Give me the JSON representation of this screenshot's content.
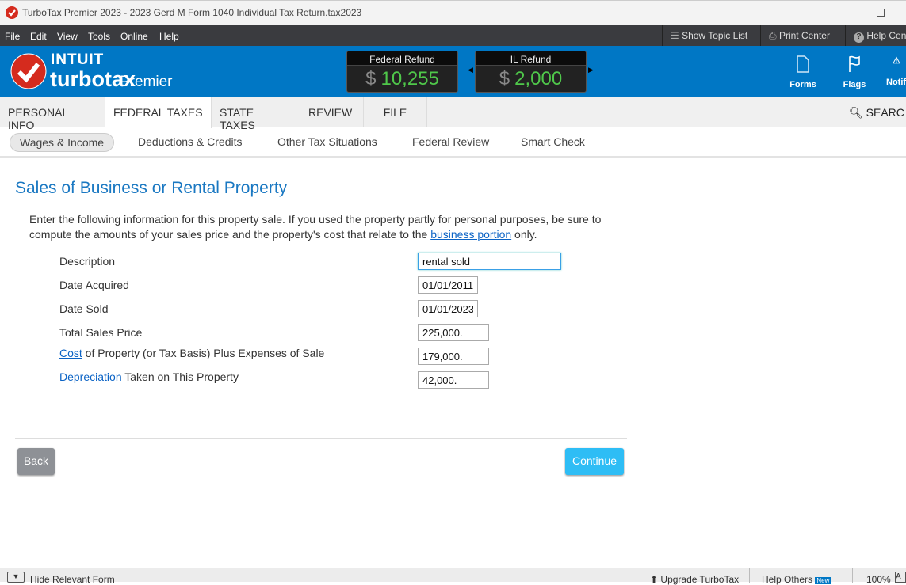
{
  "window": {
    "title": "TurboTax Premier 2023 - 2023 Gerd M Form 1040  Individual Tax Return.tax2023"
  },
  "menu": [
    "File",
    "Edit",
    "View",
    "Tools",
    "Online",
    "Help"
  ],
  "toolbar": {
    "topic_list": "Show Topic List",
    "print_center": "Print Center",
    "help_center": "Help Cen"
  },
  "brand": {
    "company": "INTUIT",
    "product": "turbotax",
    "edition": "Premier"
  },
  "refunds": [
    {
      "label": "Federal Refund",
      "currency": "$",
      "amount": "10,255"
    },
    {
      "label": "IL Refund",
      "currency": "$",
      "amount": "2,000"
    }
  ],
  "header_icons": [
    {
      "label": "Forms",
      "icon": "document-icon"
    },
    {
      "label": "Flags",
      "icon": "flag-icon"
    },
    {
      "label": "Notifi",
      "icon": "bell-icon"
    }
  ],
  "tabs": [
    "PERSONAL INFO",
    "FEDERAL TAXES",
    "STATE TAXES",
    "REVIEW",
    "FILE"
  ],
  "active_tab": "FEDERAL TAXES",
  "search_label": "SEARC",
  "subnav": [
    "Wages & Income",
    "Deductions & Credits",
    "Other Tax Situations",
    "Federal Review",
    "Smart Check"
  ],
  "active_subnav": "Wages & Income",
  "page": {
    "title": "Sales of Business or Rental Property",
    "intro": "Enter the following information for this property sale. If you used the property partly for personal purposes, be sure to compute the amounts of your sales price and the property's cost that relate to the",
    "intro_link": "business portion",
    "intro_end": " only.",
    "fields": {
      "description": {
        "label": "Description",
        "value": "rental sold"
      },
      "date_acquired": {
        "label": "Date Acquired",
        "value": "01/01/2011"
      },
      "date_sold": {
        "label": "Date Sold",
        "value": "01/01/2023"
      },
      "sales_price": {
        "label": "Total Sales Price",
        "value": "225,000."
      },
      "cost": {
        "link": "Cost",
        "label": " of Property (or Tax Basis) Plus Expenses of Sale",
        "value": "179,000."
      },
      "depreciation": {
        "link": "Depreciation",
        "label": " Taken on This Property",
        "value": "42,000."
      }
    },
    "back": "Back",
    "continue": "Continue"
  },
  "footer": {
    "hide_form": "Hide Relevant Form",
    "upgrade": "Upgrade TurboTax",
    "help_others": "Help Others",
    "new_badge": "New",
    "zoom": "100%"
  },
  "colors": {
    "brand_blue": "#0077c5",
    "refund_green": "#4fc74a",
    "continue": "#2ebdf5",
    "back": "#8e9196",
    "title": "#1a78c2"
  }
}
